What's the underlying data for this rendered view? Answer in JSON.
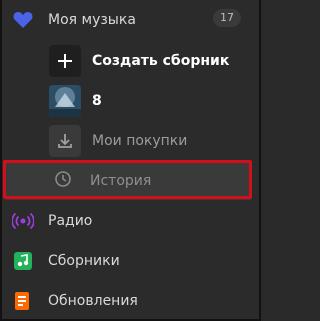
{
  "menu": {
    "my_music": {
      "label": "Моя музыка",
      "count": "17",
      "icon": "heart-icon"
    },
    "sub_items": [
      {
        "label": "Создать сборник",
        "icon": "plus-icon"
      },
      {
        "label": "8",
        "icon": "album-cover"
      },
      {
        "label": "Мои покупки",
        "icon": "download-icon"
      },
      {
        "label": "История",
        "icon": "clock-icon"
      }
    ],
    "main_items": [
      {
        "label": "Радио",
        "icon": "radio-icon"
      },
      {
        "label": "Сборники",
        "icon": "collections-icon"
      },
      {
        "label": "Обновления",
        "icon": "updates-icon"
      }
    ]
  },
  "colors": {
    "background": "#2b2b2b",
    "highlight_border": "#d40f1b",
    "heart": "#4b63e6",
    "radio": "#9b3ee0",
    "collections": "#24b15b",
    "updates": "#ff6a00"
  }
}
